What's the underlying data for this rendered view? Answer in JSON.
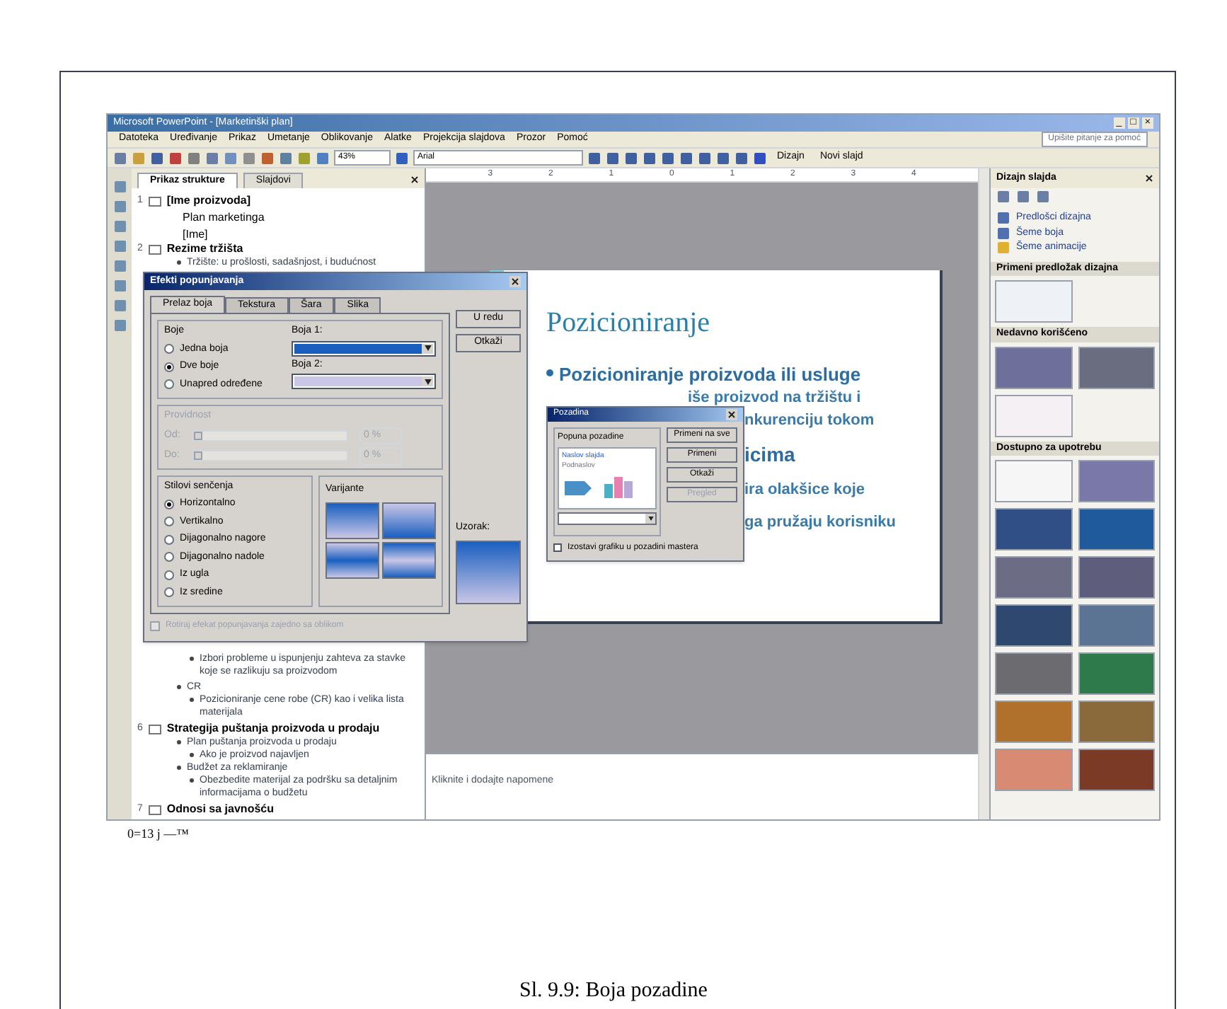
{
  "window": {
    "title": "Microsoft PowerPoint - [Marketinški plan]",
    "help_box": "Upišite pitanje za pomoć",
    "controls": [
      "_",
      "□",
      "×"
    ]
  },
  "menu": [
    "Datoteka",
    "Uređivanje",
    "Prikaz",
    "Umetanje",
    "Oblikovanje",
    "Alatke",
    "Projekcija slajdova",
    "Prozor",
    "Pomoć"
  ],
  "toolbar": {
    "zoom": "43%",
    "font": "Arial",
    "buttons": [
      "Dizajn",
      "Novi slajd"
    ]
  },
  "outline": {
    "tabs": [
      {
        "label": "Prikaz strukture",
        "selected": true
      },
      {
        "label": "Slajdovi",
        "selected": false
      }
    ],
    "items_top": [
      {
        "kind": "slide",
        "number": "1",
        "text": "[Ime proizvoda]",
        "children": [
          {
            "kind": "text",
            "text": "Plan marketinga"
          },
          {
            "kind": "text",
            "text": "[Ime]"
          }
        ]
      },
      {
        "kind": "slide",
        "number": "2",
        "text": "Rezime tržišta",
        "children": [
          {
            "kind": "bullet",
            "text": "Tržište: u prošlosti, sadašnjost, i budućnost"
          }
        ]
      }
    ],
    "items_bottom": [
      {
        "kind": "group",
        "children": [
          {
            "kind": "bullet",
            "text": "Izbori probleme u ispunjenju zahteva za stavke koje se razlikuju sa proizvodom"
          }
        ]
      },
      {
        "kind": "bullet",
        "text": "CR",
        "children": [
          {
            "kind": "bullet",
            "text": "Pozicioniranje cene robe (CR) kao i velika lista materijala"
          }
        ]
      },
      {
        "kind": "slide",
        "number": "6",
        "text": "Strategija puštanja proizvoda u prodaju",
        "children": [
          {
            "kind": "bullet",
            "text": "Plan puštanja proizvoda u prodaju",
            "children": [
              {
                "kind": "bullet",
                "text": "Ako je proizvod najavljen"
              }
            ]
          },
          {
            "kind": "bullet",
            "text": "Budžet za reklamiranje",
            "children": [
              {
                "kind": "bullet",
                "text": "Obezbedite materijal za podršku sa detaljnim informacijama o budžetu"
              }
            ]
          }
        ]
      },
      {
        "kind": "slide",
        "number": "7",
        "text": "Odnosi sa javnošću"
      }
    ]
  },
  "ruler": [
    "3",
    "2",
    "1",
    "0",
    "1",
    "2",
    "3",
    "4"
  ],
  "slide": {
    "title": "Pozicioniranje",
    "bullet": "Pozicioniranje proizvoda ili usluge",
    "lead_fragment": "iše proizvod na tržištu i",
    "fragments": [
      {
        "kind": "sub",
        "text": "nkurenciju tokom"
      },
      {
        "kind": "main",
        "text": "icima"
      },
      {
        "kind": "sub",
        "text": "ira olakšice koje"
      },
      {
        "kind": "sub",
        "text": "ga pružaju korisniku"
      }
    ]
  },
  "notes": {
    "placeholder": "Kliknite i dodajte napomene"
  },
  "fill_dialog": {
    "title": "Efekti popunjavanja",
    "tabs": [
      {
        "label": "Prelaz boja",
        "selected": true
      },
      {
        "label": "Tekstura",
        "selected": false
      },
      {
        "label": "Šara",
        "selected": false
      },
      {
        "label": "Slika",
        "selected": false
      }
    ],
    "colors_label": "Boje",
    "color_options": [
      {
        "label": "Jedna boja",
        "selected": false
      },
      {
        "label": "Dve boje",
        "selected": true
      },
      {
        "label": "Unapred određene",
        "selected": false
      }
    ],
    "color_pickers": [
      {
        "label": "Boja 1:",
        "color": "#1a5fc0"
      },
      {
        "label": "Boja 2:",
        "color": "#c9c6e6"
      }
    ],
    "transparency": {
      "label": "Providnost",
      "rows": [
        {
          "label": "Od:",
          "value": "0 %",
          "level": 0
        },
        {
          "label": "Do:",
          "value": "0 %",
          "level": 0
        }
      ]
    },
    "shading_label": "Stilovi senčenja",
    "shading_options": [
      {
        "label": "Horizontalno",
        "selected": true
      },
      {
        "label": "Vertikalno",
        "selected": false
      },
      {
        "label": "Dijagonalno nagore",
        "selected": false
      },
      {
        "label": "Dijagonalno nadole",
        "selected": false
      },
      {
        "label": "Iz ugla",
        "selected": false
      },
      {
        "label": "Iz sredine",
        "selected": false
      }
    ],
    "variants_label": "Varijante",
    "sample_label": "Uzorak:",
    "buttons": [
      "U redu",
      "Otkaži"
    ],
    "rotate": {
      "label": "Rotiraj efekat popunjavanja zajedno sa oblikom",
      "checked": false
    }
  },
  "background_dialog": {
    "title": "Pozadina",
    "group": "Popuna pozadine",
    "preview": [
      "Naslov slajda",
      "Podnaslov"
    ],
    "buttons": [
      {
        "label": "Primeni na sve",
        "disabled": false
      },
      {
        "label": "Primeni",
        "disabled": false
      },
      {
        "label": "Otkaži",
        "disabled": false
      },
      {
        "label": "Pregled",
        "disabled": true
      }
    ],
    "omit": {
      "label": "Izostavi grafiku u pozadini mastera",
      "checked": false
    }
  },
  "task_pane": {
    "title": "Dizajn slajda",
    "links": [
      "Predlošci dizajna",
      "Šeme boja",
      "Šeme animacije"
    ],
    "sections": [
      {
        "title": "Primeni predložak dizajna",
        "thumbs": [
          {
            "color": "#eef2f6"
          }
        ]
      },
      {
        "title": "Nedavno korišćeno",
        "thumbs": [
          {
            "color": "#6f6f9c"
          },
          {
            "color": "#6a6c80"
          },
          {
            "color": "#f4f0f4"
          }
        ]
      },
      {
        "title": "Dostupno za upotrebu",
        "thumbs": [
          {
            "color": "#f6f6f6"
          },
          {
            "color": "#7a78a8"
          },
          {
            "color": "#2f4f86"
          },
          {
            "color": "#1f5a9c"
          },
          {
            "color": "#6c6c84"
          },
          {
            "color": "#5f5d7c"
          },
          {
            "color": "#2e4870"
          },
          {
            "color": "#5c7494"
          },
          {
            "color": "#6b6b70"
          },
          {
            "color": "#2f7a4a"
          },
          {
            "color": "#b0712c"
          },
          {
            "color": "#8a6a3a"
          },
          {
            "color": "#d98a72"
          },
          {
            "color": "#7a3a26"
          }
        ]
      }
    ]
  },
  "footer_text": "0=13 j —™",
  "caption": "Sl. 9.9: Boja pozadine"
}
